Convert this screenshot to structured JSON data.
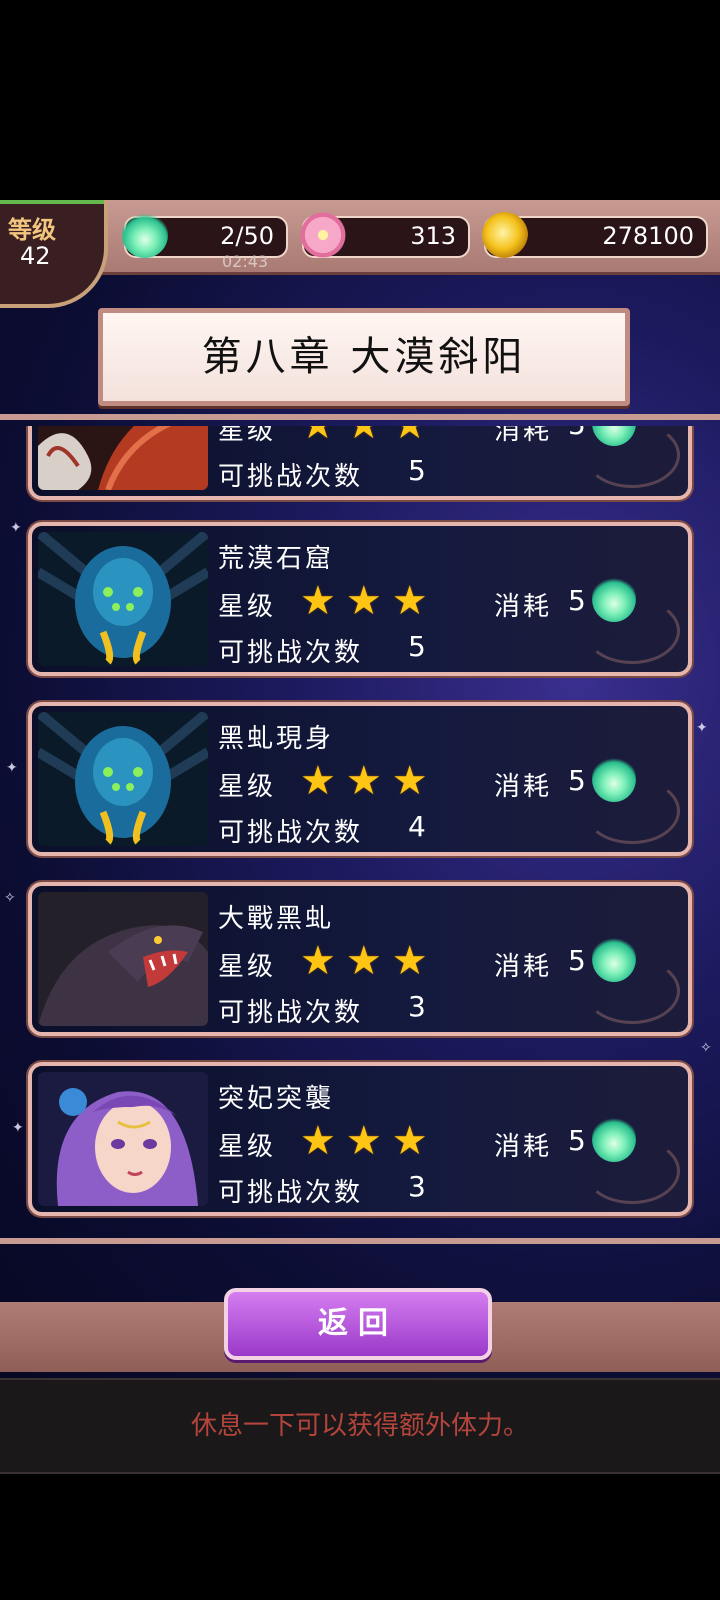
{
  "level": {
    "label": "等级",
    "value": "42"
  },
  "resources": {
    "stamina": {
      "icon": "stamina-spirit-icon",
      "amount": "2/50",
      "timer": "02:43"
    },
    "flowers": {
      "icon": "flower-icon",
      "amount": "313"
    },
    "gold": {
      "icon": "gold-coin-icon",
      "amount": "278100"
    }
  },
  "chapter_title": "第八章 大漠斜阳",
  "stage_labels": {
    "stars": "星级",
    "attempts": "可挑战次数",
    "cost": "消耗"
  },
  "stages": [
    {
      "name": "",
      "stars": 3,
      "attempts": "5",
      "cost": "5",
      "portrait": "red-serpent"
    },
    {
      "name": "荒漠石窟",
      "stars": 3,
      "attempts": "5",
      "cost": "5",
      "portrait": "blue-beast"
    },
    {
      "name": "黑虬現身",
      "stars": 3,
      "attempts": "4",
      "cost": "5",
      "portrait": "blue-beast"
    },
    {
      "name": "大戰黑虬",
      "stars": 3,
      "attempts": "3",
      "cost": "5",
      "portrait": "black-serpent"
    },
    {
      "name": "突妃突襲",
      "stars": 3,
      "attempts": "3",
      "cost": "5",
      "portrait": "purple-lady"
    }
  ],
  "back_button": "返回",
  "tip": "休息一下可以获得额外体力。",
  "colors": {
    "star": "#ffc515",
    "frame": "#e6b6ae",
    "button": "#b04fd9",
    "tip_text": "#b3453c"
  }
}
